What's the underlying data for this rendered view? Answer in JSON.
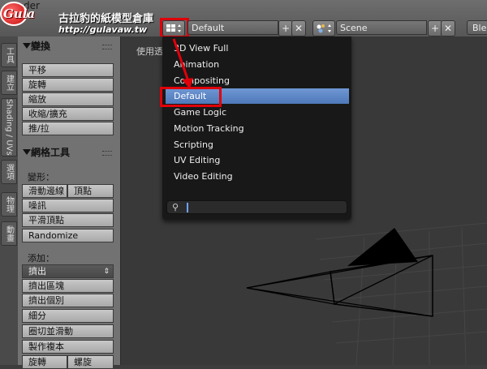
{
  "window": {
    "title_partial": "ender"
  },
  "watermark": {
    "logo_text": "Gula",
    "title": "古拉豹的紙模型倉庫",
    "url": "http://gulavaw.tw"
  },
  "header": {
    "layout": {
      "value": "Default",
      "add": "+",
      "remove": "✕"
    },
    "scene": {
      "value": "Scene",
      "add": "+",
      "remove": "✕"
    },
    "engine": {
      "value_partial": "Ble"
    }
  },
  "layout_menu": {
    "items": [
      {
        "label": "3D View Full",
        "selected": false
      },
      {
        "label": "Animation",
        "selected": false
      },
      {
        "label": "Compositing",
        "selected": false
      },
      {
        "label": "Default",
        "selected": true
      },
      {
        "label": "Game Logic",
        "selected": false
      },
      {
        "label": "Motion Tracking",
        "selected": false
      },
      {
        "label": "Scripting",
        "selected": false
      },
      {
        "label": "UV Editing",
        "selected": false
      },
      {
        "label": "Video Editing",
        "selected": false
      }
    ],
    "search_value": ""
  },
  "side_tabs": [
    "工具",
    "建立",
    "Shading / UVs",
    "選項",
    "物理",
    "動畫"
  ],
  "tool_shelf": {
    "transform": {
      "title": "變換",
      "buttons": [
        "平移",
        "旋轉",
        "縮放",
        "收縮/擴充",
        "推/拉"
      ]
    },
    "mesh_tools": {
      "title": "網格工具",
      "deform_label": "變形：",
      "deform_buttons": [
        "滑動邊線",
        "頂點",
        "噪訊",
        "平滑頂點",
        "Randomize"
      ],
      "add_label": "添加：",
      "extrude_select": "擠出",
      "add_buttons": [
        "擠出區塊",
        "擠出個別",
        "細分",
        "圈切並滑動",
        "製作複本"
      ],
      "bottom_buttons": [
        "旋轉",
        "螺旋"
      ]
    }
  },
  "viewport": {
    "label_partial": "使用透"
  },
  "colors": {
    "highlight": "#e0000a",
    "menu_selected": "#5a84c6"
  }
}
